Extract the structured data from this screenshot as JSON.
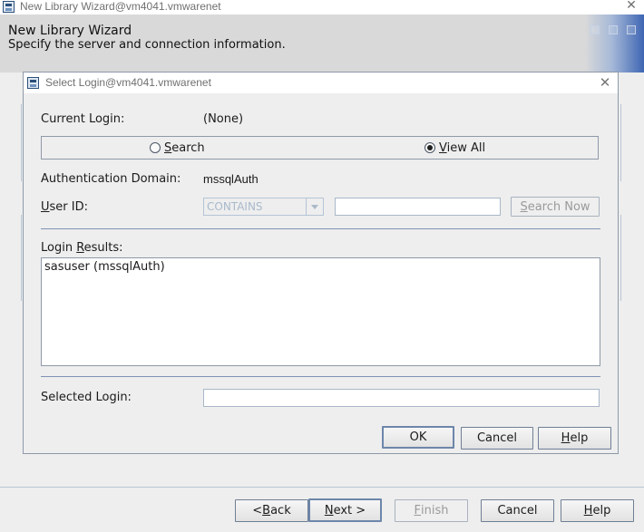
{
  "outer_window": {
    "title": "New Library Wizard@vm4041.vmwarenet",
    "close_glyph": "✕",
    "header_title": "New Library Wizard",
    "header_subtitle": "Specify the server and connection information."
  },
  "outer_buttons": {
    "back": {
      "pre": "< ",
      "mnemonic": "B",
      "post": "ack"
    },
    "next": {
      "pre": "",
      "mnemonic": "N",
      "post": "ext >"
    },
    "finish": {
      "pre": "",
      "mnemonic": "F",
      "post": "inish"
    },
    "cancel": {
      "label": "Cancel"
    },
    "help": {
      "pre": "",
      "mnemonic": "H",
      "post": "elp"
    }
  },
  "dialog": {
    "title": "Select Login@vm4041.vmwarenet",
    "close_glyph": "✕",
    "current_login_label": "Current Login:",
    "current_login_value": "(None)",
    "radio_search": {
      "pre": "",
      "mnemonic": "S",
      "post": "earch",
      "selected": false
    },
    "radio_view_all": {
      "pre": "",
      "mnemonic": "V",
      "post": "iew All",
      "selected": true
    },
    "auth_domain_label": "Authentication Domain:",
    "auth_domain_value": "mssqlAuth",
    "user_id_label": {
      "pre": "",
      "mnemonic": "U",
      "post": "ser ID:"
    },
    "user_id_operator": "CONTAINS",
    "user_id_value": "",
    "search_now": {
      "pre": "",
      "mnemonic": "S",
      "post": "earch Now"
    },
    "login_results_label": {
      "pre": "Login ",
      "mnemonic": "R",
      "post": "esults:"
    },
    "login_results": [
      "sasuser (mssqlAuth)"
    ],
    "selected_login_label": "Selected Login:",
    "selected_login_value": "",
    "ok": "OK",
    "cancel": "Cancel",
    "help": {
      "pre": "",
      "mnemonic": "H",
      "post": "elp"
    }
  },
  "colors": {
    "accent": "#3f66b3",
    "window_bg": "#eeeeee",
    "header_bg": "#d9d9d9"
  }
}
